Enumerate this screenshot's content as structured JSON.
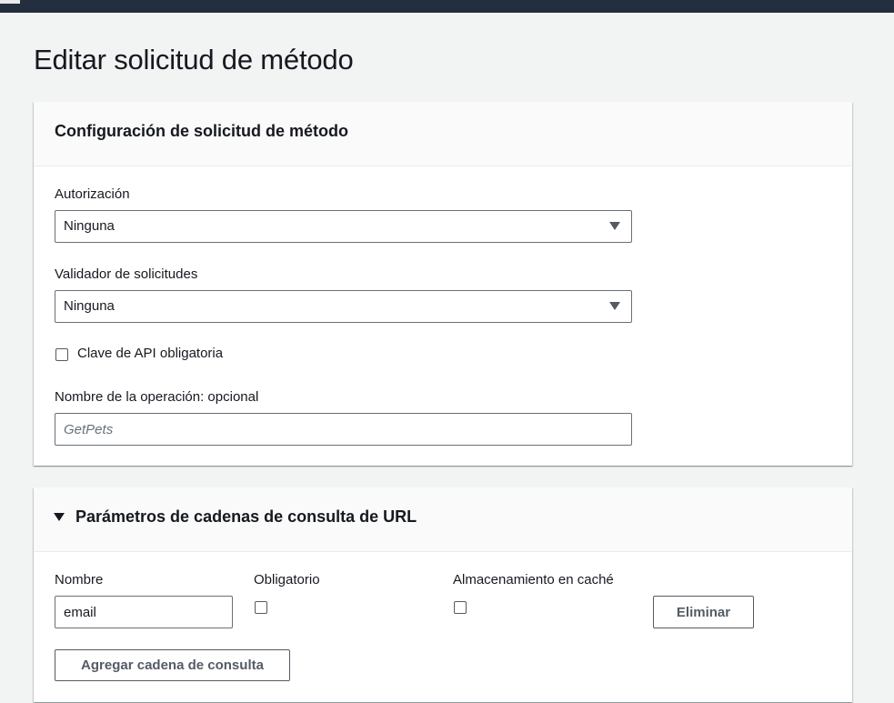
{
  "page": {
    "title": "Editar solicitud de método"
  },
  "method_request_settings": {
    "title": "Configuración de solicitud de método",
    "authorization": {
      "label": "Autorización",
      "value": "Ninguna"
    },
    "request_validator": {
      "label": "Validador de solicitudes",
      "value": "Ninguna"
    },
    "api_key_required": {
      "label": "Clave de API obligatoria",
      "checked": false
    },
    "operation_name": {
      "label": "Nombre de la operación: opcional",
      "placeholder": "GetPets",
      "value": ""
    }
  },
  "url_query_params": {
    "title": "Parámetros de cadenas de consulta de URL",
    "expanded": true,
    "columns": {
      "name": "Nombre",
      "required": "Obligatorio",
      "caching": "Almacenamiento en caché"
    },
    "rows": [
      {
        "name": "email",
        "required": false,
        "caching": false,
        "remove_label": "Eliminar"
      }
    ],
    "add_button_label": "Agregar cadena de consulta"
  },
  "colors": {
    "topbar": "#232f3e",
    "link": "#0073bb",
    "page_bg": "#f2f3f3",
    "border": "#687078"
  }
}
